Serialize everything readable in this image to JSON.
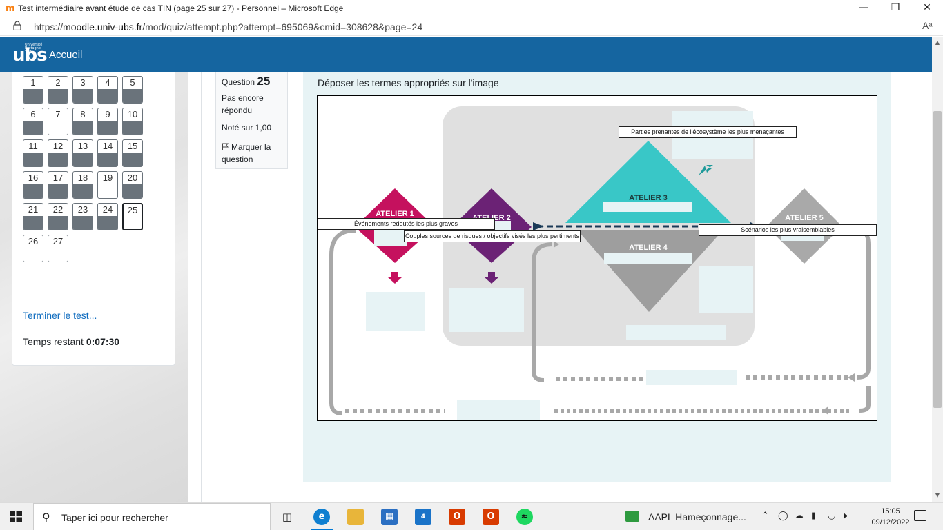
{
  "browser": {
    "title": "Test intermédiaire avant étude de cas TIN (page 25 sur 27) - Personnel – Microsoft Edge",
    "favicon": "m",
    "url_prefix": "https://",
    "url_domain": "moodle.univ-ubs.fr",
    "url_path": "/mod/quiz/attempt.php?attempt=695069&cmid=308628&page=24",
    "read_aloud_icon": "Aᵃ"
  },
  "navbar": {
    "logo": "ubs",
    "logo_small": "Université Bretagne Sud",
    "home_label": "Accueil"
  },
  "quiz_nav": {
    "buttons": [
      {
        "n": "1",
        "answered": true
      },
      {
        "n": "2",
        "answered": true
      },
      {
        "n": "3",
        "answered": true
      },
      {
        "n": "4",
        "answered": true
      },
      {
        "n": "5",
        "answered": true
      },
      {
        "n": "6",
        "answered": true
      },
      {
        "n": "7",
        "answered": false
      },
      {
        "n": "8",
        "answered": true
      },
      {
        "n": "9",
        "answered": true
      },
      {
        "n": "10",
        "answered": true
      },
      {
        "n": "11",
        "answered": true
      },
      {
        "n": "12",
        "answered": true
      },
      {
        "n": "13",
        "answered": true
      },
      {
        "n": "14",
        "answered": true
      },
      {
        "n": "15",
        "answered": true
      },
      {
        "n": "16",
        "answered": true
      },
      {
        "n": "17",
        "answered": true
      },
      {
        "n": "18",
        "answered": true
      },
      {
        "n": "19",
        "answered": false
      },
      {
        "n": "20",
        "answered": true
      },
      {
        "n": "21",
        "answered": true
      },
      {
        "n": "22",
        "answered": true
      },
      {
        "n": "23",
        "answered": true
      },
      {
        "n": "24",
        "answered": true
      },
      {
        "n": "25",
        "answered": false,
        "current": true
      },
      {
        "n": "26",
        "answered": false
      },
      {
        "n": "27",
        "answered": false
      }
    ],
    "finish_label": "Terminer le test...",
    "time_label": "Temps restant",
    "time_value": "0:07:30"
  },
  "question_info": {
    "label": "Question",
    "number": "25",
    "state": "Pas encore répondu",
    "grade": "Noté sur 1,00",
    "flag_label": "Marquer la question"
  },
  "question": {
    "prompt": "Déposer les termes appropriés sur l'image",
    "ateliers": [
      "ATELIER 1",
      "ATELIER 2",
      "ATELIER 3",
      "ATELIER 4",
      "ATELIER 5"
    ],
    "drag_items": [
      "Parties prenantes de l'écosystème les plus menaçantes",
      "Événements redoutés les plus graves",
      "Couples sources de risques / objectifs visés les plus pertiments",
      "Scénarios les plus vraisemblables"
    ],
    "colors": {
      "atelier1": "#c5115e",
      "atelier2": "#6b2275",
      "atelier3": "#39c7c7",
      "atelier4": "#9e9e9e",
      "atelier5": "#a9a9a9",
      "dropzone": "#e7f3f5",
      "arrow_dark": "#1b3a57"
    }
  },
  "taskbar": {
    "search_placeholder": "Taper ici pour rechercher",
    "mail_badge": "4",
    "stock_text": "AAPL  Hameçonnage...",
    "time": "15:05",
    "date": "09/12/2022",
    "icons": [
      "windows-start-icon",
      "task-view-icon",
      "edge-icon",
      "file-explorer-icon",
      "store-icon",
      "mail-icon",
      "office-icon",
      "office-app-icon",
      "spotify-icon"
    ]
  }
}
